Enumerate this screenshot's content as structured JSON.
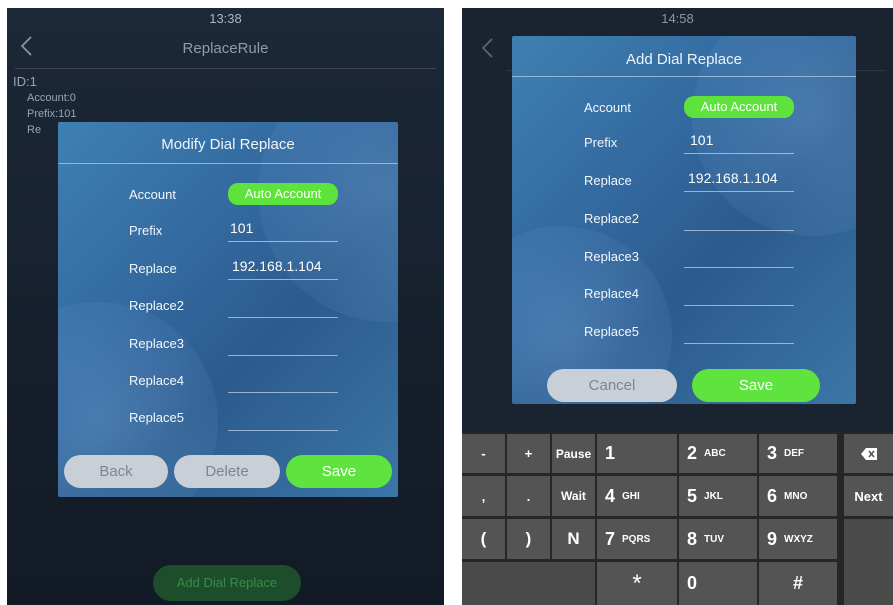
{
  "left": {
    "status_time": "13:38",
    "header_title": "ReplaceRule",
    "rule": {
      "id": "ID:1",
      "account": "Account:0",
      "prefix": "Prefix:101",
      "replace_partial": "Re"
    },
    "dialog": {
      "title": "Modify Dial Replace",
      "fields": [
        {
          "label": "Account",
          "value": "Auto Account"
        },
        {
          "label": "Prefix",
          "value": "101"
        },
        {
          "label": "Replace",
          "value": "192.168.1.104"
        },
        {
          "label": "Replace2",
          "value": ""
        },
        {
          "label": "Replace3",
          "value": ""
        },
        {
          "label": "Replace4",
          "value": ""
        },
        {
          "label": "Replace5",
          "value": ""
        }
      ],
      "buttons": {
        "back": "Back",
        "delete": "Delete",
        "save": "Save"
      }
    },
    "add_button": "Add Dial Replace"
  },
  "right": {
    "status_time": "14:58",
    "dialog": {
      "title": "Add Dial Replace",
      "fields": [
        {
          "label": "Account",
          "value": "Auto Account"
        },
        {
          "label": "Prefix",
          "value": "101"
        },
        {
          "label": "Replace",
          "value": "192.168.1.104"
        },
        {
          "label": "Replace2",
          "value": ""
        },
        {
          "label": "Replace3",
          "value": ""
        },
        {
          "label": "Replace4",
          "value": ""
        },
        {
          "label": "Replace5",
          "value": ""
        }
      ],
      "buttons": {
        "cancel": "Cancel",
        "save": "Save"
      }
    },
    "keypad": {
      "row1": {
        "minus": "-",
        "plus": "+",
        "pause": "Pause",
        "k1": "1",
        "k2": "2",
        "k2_letters": "ABC",
        "k3": "3",
        "k3_letters": "DEF"
      },
      "row2": {
        "comma": ",",
        "period": ".",
        "wait": "Wait",
        "k4": "4",
        "k4_letters": "GHI",
        "k5": "5",
        "k5_letters": "JKL",
        "k6": "6",
        "k6_letters": "MNO",
        "next": "Next"
      },
      "row3": {
        "lparen": "(",
        "rparen": ")",
        "n": "N",
        "k7": "7",
        "k7_letters": "PQRS",
        "k8": "8",
        "k8_letters": "TUV",
        "k9": "9",
        "k9_letters": "WXYZ"
      },
      "row4": {
        "star": "*",
        "k0": "0",
        "hash": "#"
      }
    }
  },
  "colors": {
    "accent_green": "#5ee23c",
    "dialog_blue": "#336aa0",
    "key_gray": "#545454"
  },
  "icons": [
    "back-chevron-icon",
    "backspace-icon"
  ]
}
